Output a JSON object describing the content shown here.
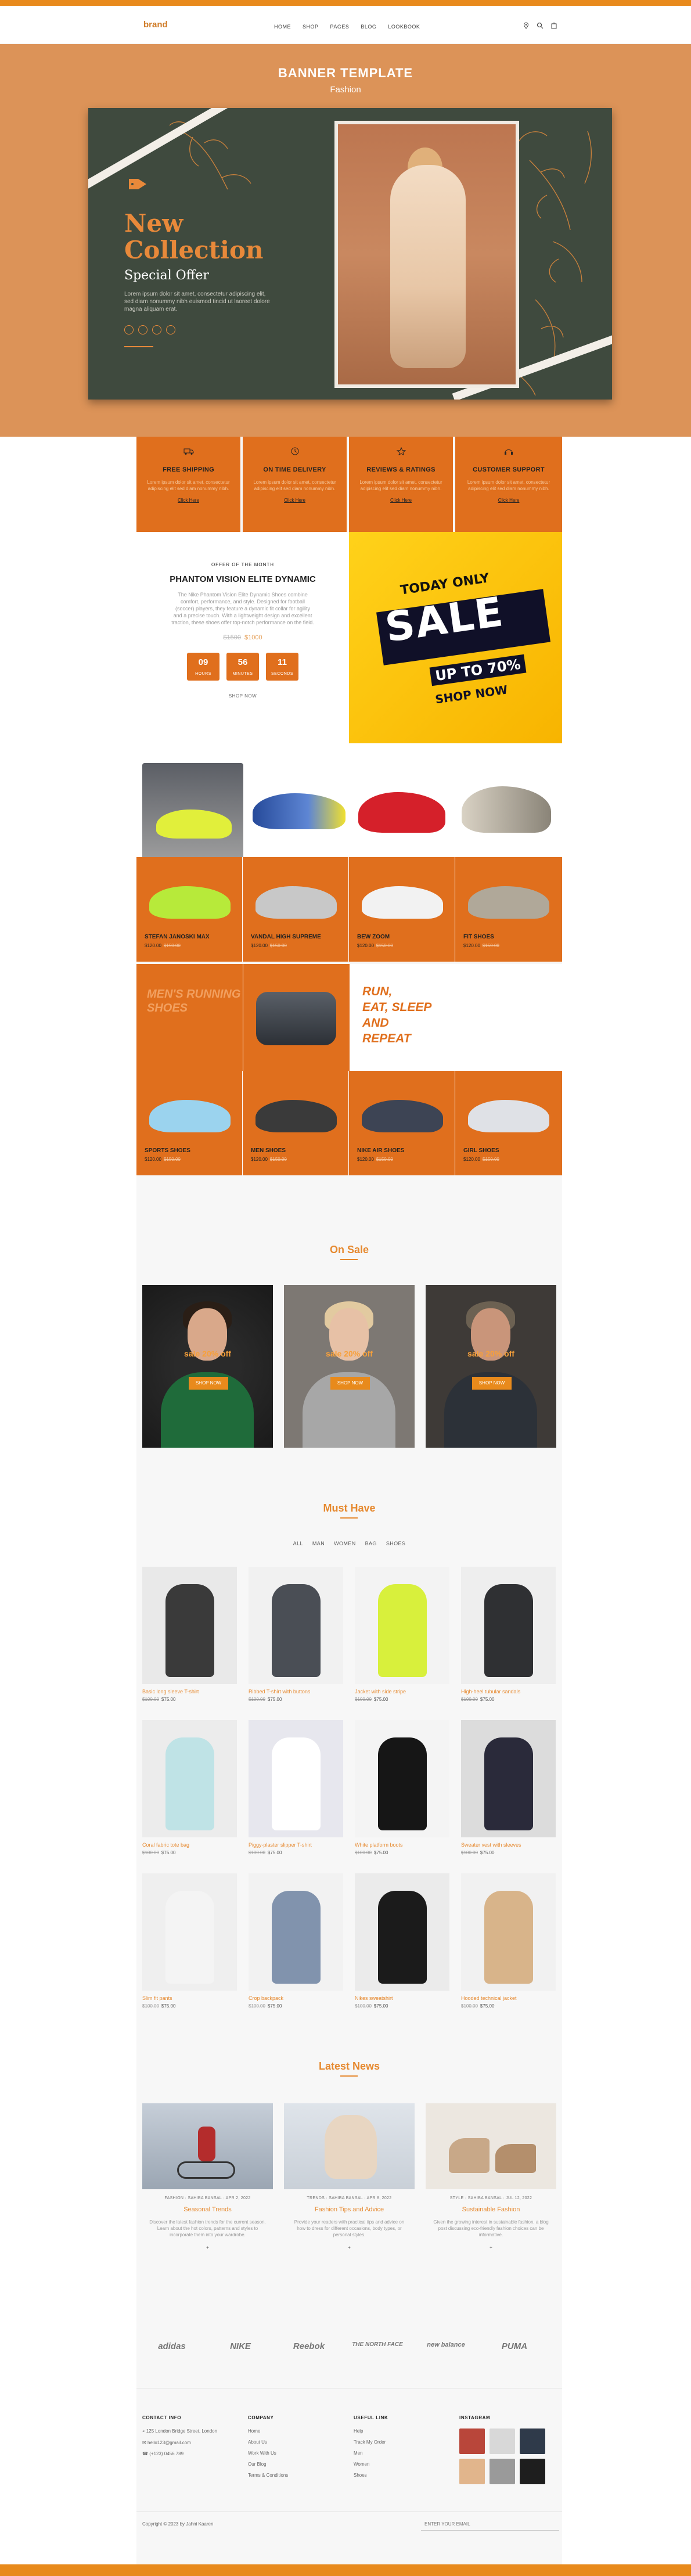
{
  "header": {
    "brand": "brand",
    "nav": [
      "HOME",
      "SHOP",
      "PAGES",
      "BLOG",
      "LOOKBOOK"
    ]
  },
  "banner": {
    "title": "BANNER TEMPLATE",
    "subtitle": "Fashion",
    "card_headline_1": "New",
    "card_headline_2": "Collection",
    "card_offer": "Special Offer",
    "card_desc": "Lorem ipsum dolor sit amet, consectetur adipiscing elit, sed diam nonummy nibh euismod tincid ut laoreet dolore magna aliquam erat."
  },
  "services": [
    {
      "title": "FREE SHIPPING",
      "text": "Lorem ipsum dolor sit amet, consectetur adipiscing elit sed diam nonummy nibh.",
      "link": "Click Here"
    },
    {
      "title": "ON TIME DELIVERY",
      "text": "Lorem ipsum dolor sit amet, consectetur adipiscing elit sed diam nonummy nibh.",
      "link": "Click Here"
    },
    {
      "title": "REVIEWS & RATINGS",
      "text": "Lorem ipsum dolor sit amet, consectetur adipiscing elit sed diam nonummy nibh.",
      "link": "Click Here"
    },
    {
      "title": "CUSTOMER SUPPORT",
      "text": "Lorem ipsum dolor sit amet, consectetur adipiscing elit sed diam nonummy nibh.",
      "link": "Click Here"
    }
  ],
  "offer": {
    "kicker": "OFFER OF THE MONTH",
    "title": "PHANTOM VISION ELITE DYNAMIC",
    "desc": "The Nike Phantom Vision Elite Dynamic Shoes combine comfort, performance, and style. Designed for football (soccer) players, they feature a dynamic fit collar for agility and a precise touch. With a lightweight design and excellent traction, these shoes offer top-notch performance on the field.",
    "old_price": "$1500",
    "price": "$1000",
    "countdown": [
      {
        "value": "09",
        "label": "HOURS"
      },
      {
        "value": "56",
        "label": "MINUTES"
      },
      {
        "value": "11",
        "label": "SECONDS"
      }
    ],
    "shop_now": "SHOP NOW"
  },
  "sale_banner": {
    "today": "TODAY ONLY",
    "word": "SALE",
    "upto": "UP TO 70%",
    "shop": "SHOP NOW"
  },
  "shoe_grid_row1": [
    {
      "name": "STEFAN JANOSKI MAX",
      "price": "$120.00",
      "old": "$150.00",
      "color": "#b7ea3a"
    },
    {
      "name": "VANDAL HIGH SUPREME",
      "price": "$120.00",
      "old": "$150.00",
      "color": "#c8c8c8"
    },
    {
      "name": "BEW ZOOM",
      "price": "$120.00",
      "old": "$150.00",
      "color": "#f2f2f2"
    },
    {
      "name": "FIT SHOES",
      "price": "$120.00",
      "old": "$150.00",
      "color": "#b0a899"
    }
  ],
  "mid_row": {
    "runner_text": "MEN'S RUNNING SHOES",
    "run_text_lines": [
      "RUN,",
      "EAT, SLEEP",
      "AND",
      "REPEAT"
    ]
  },
  "shoe_grid_row2": [
    {
      "name": "SPORTS SHOES",
      "price": "$120.00",
      "old": "$150.00",
      "color": "#9bd3ee"
    },
    {
      "name": "MEN SHOES",
      "price": "$120.00",
      "old": "$150.00",
      "color": "#3a3a3a"
    },
    {
      "name": "NIKE AIR SHOES",
      "price": "$120.00",
      "old": "$150.00",
      "color": "#3d4454"
    },
    {
      "name": "GIRL SHOES",
      "price": "$120.00",
      "old": "$150.00",
      "color": "#dfe1e6"
    }
  ],
  "on_sale": {
    "title": "On Sale",
    "items": [
      {
        "label": "sale 20% off",
        "button": "SHOP NOW"
      },
      {
        "label": "sale 20% off",
        "button": "SHOP NOW"
      },
      {
        "label": "sale 20% off",
        "button": "SHOP NOW"
      }
    ]
  },
  "must_have": {
    "title": "Must Have",
    "filters": [
      "ALL",
      "MAN",
      "WOMEN",
      "BAG",
      "SHOES"
    ],
    "items": [
      {
        "name": "Basic long sleeve T-shirt",
        "old": "$100.00",
        "price": "$75.00",
        "bg": "#e9e9e9",
        "fg": "#3a3a3a"
      },
      {
        "name": "Ribbed T-shirt with buttons",
        "old": "$100.00",
        "price": "$75.00",
        "bg": "#f1f1f1",
        "fg": "#4a4e55"
      },
      {
        "name": "Jacket with side stripe",
        "old": "$100.00",
        "price": "$75.00",
        "bg": "#f3f3f3",
        "fg": "#d8f03c"
      },
      {
        "name": "High-heel tubular sandals",
        "old": "$100.00",
        "price": "$75.00",
        "bg": "#eeeeee",
        "fg": "#2f3033"
      },
      {
        "name": "Coral fabric tote bag",
        "old": "$100.00",
        "price": "$75.00",
        "bg": "#ececec",
        "fg": "#bfe3e6"
      },
      {
        "name": "Piggy-plaster slipper T-shirt",
        "old": "$100.00",
        "price": "$75.00",
        "bg": "#e7e7ee",
        "fg": "#ffffff"
      },
      {
        "name": "White platform boots",
        "old": "$100.00",
        "price": "$75.00",
        "bg": "#f4f4f4",
        "fg": "#161616"
      },
      {
        "name": "Sweater vest with sleeves",
        "old": "$100.00",
        "price": "$75.00",
        "bg": "#dcdcdc",
        "fg": "#2a2a3a"
      },
      {
        "name": "Slim fit pants",
        "old": "$100.00",
        "price": "$75.00",
        "bg": "#efefef",
        "fg": "#f4f4f4"
      },
      {
        "name": "Crop backpack",
        "old": "$100.00",
        "price": "$75.00",
        "bg": "#f2f2f2",
        "fg": "#8193ad"
      },
      {
        "name": "Nikes sweatshirt",
        "old": "$100.00",
        "price": "$75.00",
        "bg": "#ebebeb",
        "fg": "#1b1b1b"
      },
      {
        "name": "Hooded technical jacket",
        "old": "$100.00",
        "price": "$75.00",
        "bg": "#f1f1f1",
        "fg": "#d8b48a"
      }
    ]
  },
  "latest_news": {
    "title": "Latest News",
    "items": [
      {
        "meta": "FASHION  ·  SAHIBA BANSAL  ·  APR 2, 2022",
        "title": "Seasonal Trends",
        "text": "Discover the latest fashion trends for the current season. Learn about the hot colors, patterns and styles to incorporate them into your wardrobe.",
        "more": "+",
        "c1": "#c6ced8",
        "c2": "#b42c2c"
      },
      {
        "meta": "TRENDS  ·  SAHIBA BANSAL  ·  APR 8, 2022",
        "title": "Fashion Tips and Advice",
        "text": "Provide your readers with practical tips and advice on how to dress for different occasions, body types, or personal styles.",
        "more": "+",
        "c1": "#d8dee6",
        "c2": "#e8d6c2"
      },
      {
        "meta": "STYLE  ·  SAHIBA BANSAL  ·  JUL 12, 2022",
        "title": "Sustainable Fashion",
        "text": "Given the growing interest in sustainable fashion, a blog post discussing eco-friendly fashion choices can be informative.",
        "more": "+",
        "c1": "#e8e3dc",
        "c2": "#c8a888"
      }
    ]
  },
  "brands": [
    "adidas",
    "NIKE",
    "Reebok",
    "THE NORTH FACE",
    "new balance",
    "PUMA"
  ],
  "footer": {
    "contact": {
      "title": "CONTACT INFO",
      "lines": [
        "125 London Bridge Street, London",
        "hello123@gmail.com",
        "(+123) 0456 789"
      ]
    },
    "company": {
      "title": "COMPANY",
      "lines": [
        "Home",
        "About Us",
        "Work With Us",
        "Our Blog",
        "Terms & Conditions"
      ]
    },
    "useful": {
      "title": "USEFUL LINK",
      "lines": [
        "Help",
        "Track My Order",
        "Men",
        "Women",
        "Shoes"
      ]
    },
    "instagram": {
      "title": "INSTAGRAM",
      "colors": [
        "#b9463a",
        "#d8d8d8",
        "#2f3a4a",
        "#e1b58c",
        "#9a9a9a",
        "#1e1e1e"
      ]
    },
    "copyright": "Copyright © 2023 by Jahni Kaaren",
    "subscribe_placeholder": "ENTER YOUR EMAIL"
  },
  "colors": {
    "accent": "#e06f1d",
    "banner_bg": "#dc9358",
    "card_bg": "#3f4a3e",
    "highlight": "#e6892f"
  }
}
